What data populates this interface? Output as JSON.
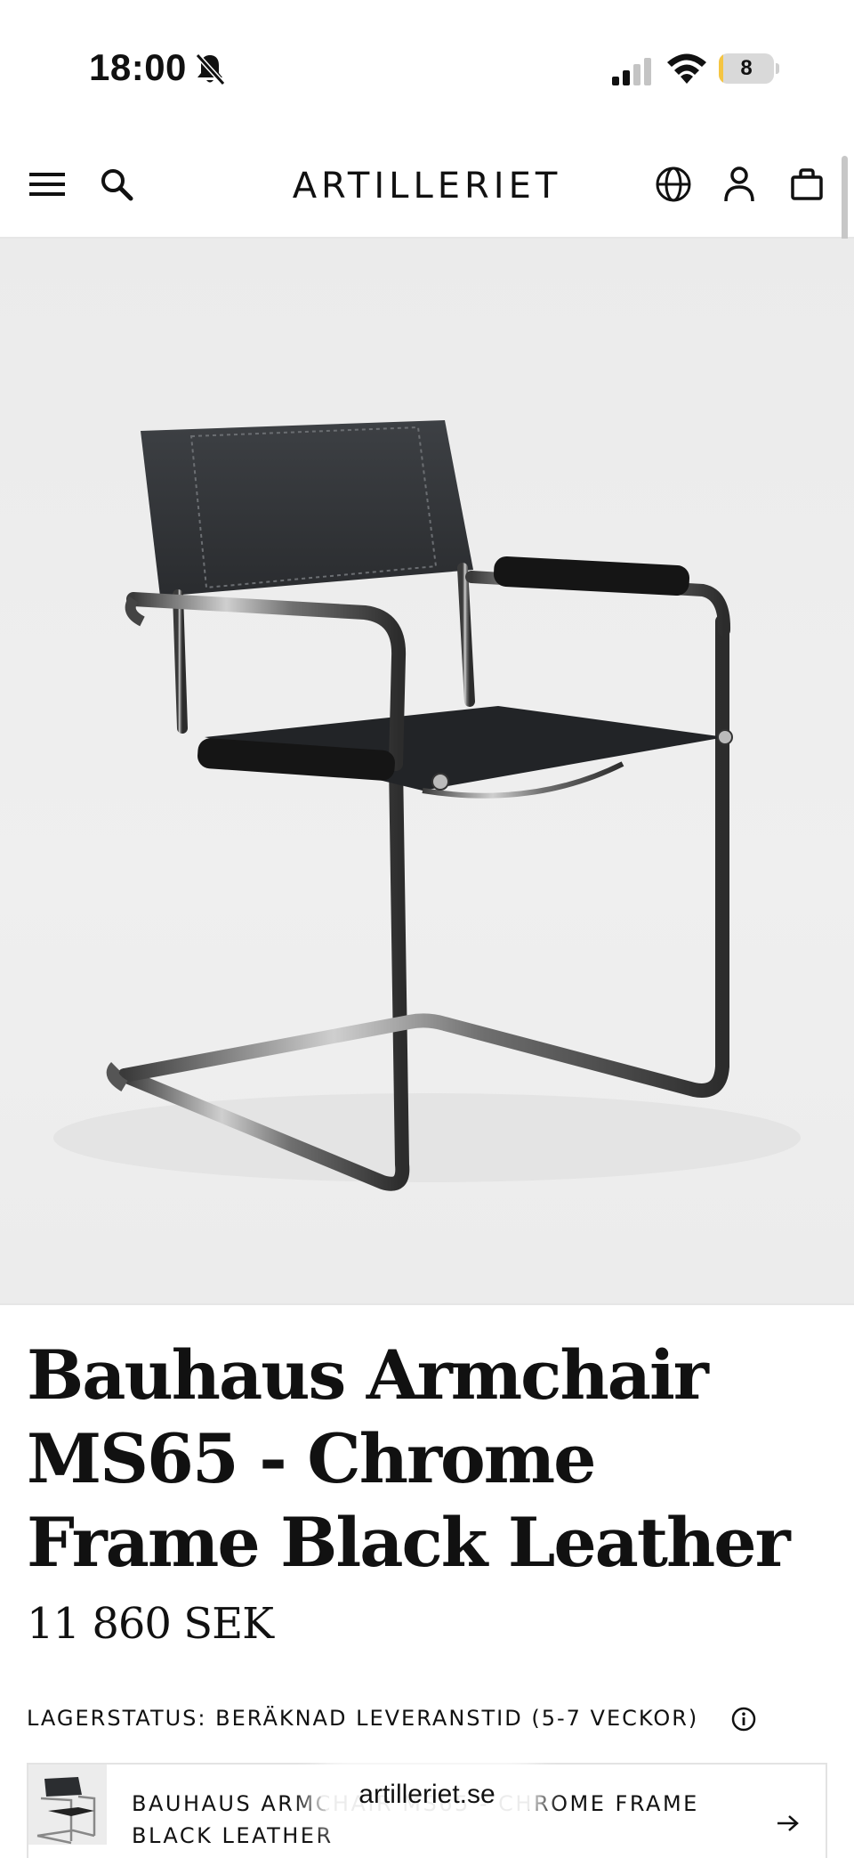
{
  "status_bar": {
    "time": "18:00",
    "battery_level": "8",
    "battery_fraction": 0.08
  },
  "header": {
    "logo": "ARTILLERIET",
    "icons": [
      "menu-icon",
      "search-icon",
      "globe-icon",
      "account-icon",
      "cart-icon"
    ]
  },
  "product": {
    "image_alt_subject": "chair-image",
    "title": "Bauhaus Armchair MS65 - Chrome Frame Black Leather",
    "price": "11 860 SEK",
    "stock_status": "LAGERSTATUS: BERÄKNAD LEVERANSTID (5-7 VECKOR)"
  },
  "variant": {
    "name": "BAUHAUS ARMCHAIR MS65 - CHROME FRAME BLACK LEATHER"
  },
  "browser": {
    "url": "artilleriet.se"
  },
  "colors": {
    "battery_fill": "#f5c542",
    "text": "#111111",
    "hero_bg": "#ececec"
  }
}
